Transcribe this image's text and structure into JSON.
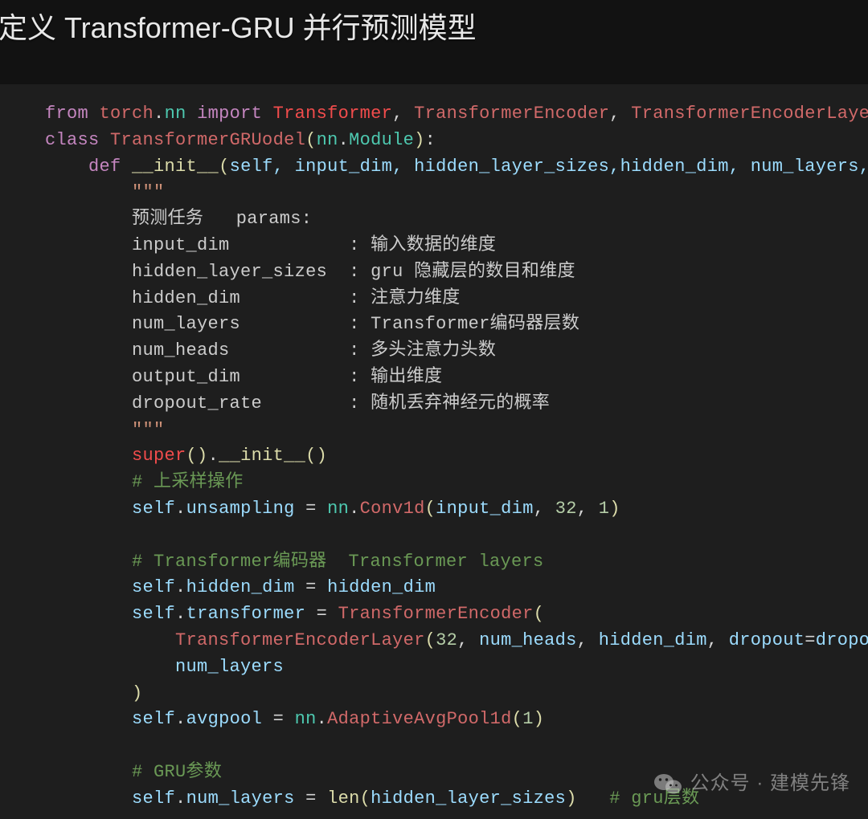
{
  "header": {
    "title": "定义 Transformer-GRU 并行预测模型"
  },
  "code": {
    "l1": {
      "from": "from",
      "mod1": "torch",
      "dot": ".",
      "mod2": "nn",
      "import": "import",
      "imp1": "Transformer",
      "imp2": "TransformerEncoder",
      "imp3": "TransformerEncoderLayer"
    },
    "l2": {
      "class": "class",
      "name": "TransformerGRUodel",
      "lp": "(",
      "nn": "nn",
      "dot": ".",
      "module": "Module",
      "rp": ")",
      "colon": ":"
    },
    "l3": {
      "def": "def",
      "name": "__init__",
      "lp": "(",
      "self": "self",
      "args": ", input_dim, hidden_layer_sizes,hidden_dim, num_layers, nu"
    },
    "l4": {
      "tri": "\"\"\""
    },
    "l5": {
      "t": "预测任务   params:"
    },
    "l6a": {
      "k": "input_dim           ",
      "s": ": ",
      "v": "输入数据的维度"
    },
    "l6b": {
      "k": "hidden_layer_sizes  ",
      "s": ": ",
      "v": "gru 隐藏层的数目和维度"
    },
    "l6c": {
      "k": "hidden_dim          ",
      "s": ": ",
      "v": "注意力维度"
    },
    "l6d": {
      "k": "num_layers          ",
      "s": ": ",
      "v": "Transformer编码器层数"
    },
    "l6e": {
      "k": "num_heads           ",
      "s": ": ",
      "v": "多头注意力头数"
    },
    "l6f": {
      "k": "output_dim          ",
      "s": ": ",
      "v": "输出维度"
    },
    "l6g": {
      "k": "dropout_rate        ",
      "s": ": ",
      "v": "随机丢弃神经元的概率"
    },
    "l7": {
      "tri": "\"\"\""
    },
    "l8": {
      "sup": "super",
      "lp": "()",
      "dot": ".",
      "init": "__init__",
      "lp2": "()"
    },
    "l9": {
      "c": "# 上采样操作"
    },
    "l10": {
      "self": "self",
      "dot": ".",
      "attr": "unsampling",
      "eq": " = ",
      "nn": "nn",
      "dot2": ".",
      "cls": "Conv1d",
      "lp": "(",
      "a1": "input_dim",
      "c1": ", ",
      "n32": "32",
      "c2": ", ",
      "n1": "1",
      "rp": ")"
    },
    "l11": {
      "c": "# Transformer编码器  Transformer layers"
    },
    "l12": {
      "self": "self",
      "dot": ".",
      "attr": "hidden_dim",
      "eq": " = ",
      "rhs": "hidden_dim"
    },
    "l13": {
      "self": "self",
      "dot": ".",
      "attr": "transformer",
      "eq": " = ",
      "cls": "TransformerEncoder",
      "lp": "("
    },
    "l14": {
      "cls": "TransformerEncoderLayer",
      "lp": "(",
      "n32": "32",
      "c1": ", ",
      "a1": "num_heads",
      "c2": ", ",
      "a2": "hidden_dim",
      "c3": ", ",
      "kw": "dropout",
      "eq": "=",
      "a3": "dropout_"
    },
    "l15": {
      "a": "num_layers"
    },
    "l16": {
      "rp": ")"
    },
    "l17": {
      "self": "self",
      "dot": ".",
      "attr": "avgpool",
      "eq": " = ",
      "nn": "nn",
      "dot2": ".",
      "cls": "AdaptiveAvgPool1d",
      "lp": "(",
      "n1": "1",
      "rp": ")"
    },
    "l18": {
      "c": "# GRU参数"
    },
    "l19": {
      "self": "self",
      "dot": ".",
      "attr": "num_layers",
      "eq": " = ",
      "len": "len",
      "lp": "(",
      "arg": "hidden_layer_sizes",
      "rp": ")",
      "sp": "   ",
      "c": "# gru层数"
    }
  },
  "watermark": {
    "text": "公众号 · 建模先锋"
  }
}
